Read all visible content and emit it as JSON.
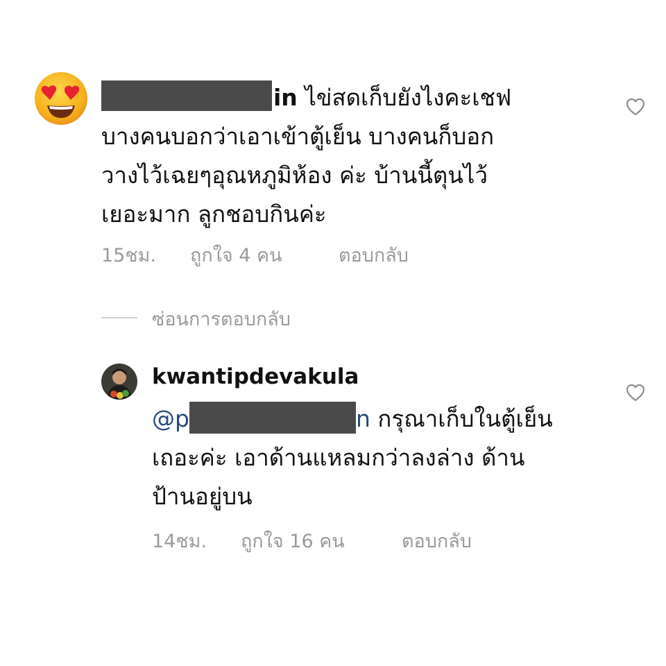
{
  "comment": {
    "avatar_icon": "heart-eyes-emoji",
    "username_visible_suffix": "in",
    "text_lines": [
      "ไข่สดเก็บยังไงคะเชฟ",
      "บางคนบอกว่าเอาเข้าตู้เย็น บางคนก็บอก",
      "วางไว้เฉยๆอุณหภูมิห้อง ค่ะ บ้านนี้ตุนไว้",
      "เยอะมาก ลูกชอบกินค่ะ"
    ],
    "time": "15ชม.",
    "likes": "ถูกใจ 4 คน",
    "reply_label": "ตอบกลับ"
  },
  "hide_replies_label": "ซ่อนการตอบกลับ",
  "reply": {
    "username": "kwantipdevakula",
    "mention_prefix": "@p",
    "mention_suffix": "n",
    "text_first": "กรุณาเก็บในตู้เย็น",
    "text_lines": [
      "เถอะค่ะ เอาด้านแหลมกว่าลงล่าง ด้าน",
      "ป้านอยู่บน"
    ],
    "time": "14ชม.",
    "likes": "ถูกใจ 16 คน",
    "reply_label": "ตอบกลับ"
  },
  "colors": {
    "text": "#111111",
    "meta": "#9a9a9a",
    "mention": "#2a4a7a",
    "redaction": "#4a4a4a"
  }
}
